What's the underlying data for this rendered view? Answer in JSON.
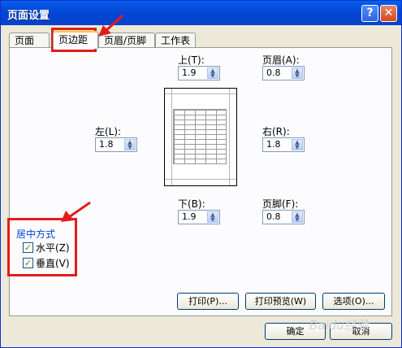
{
  "window": {
    "title": "页面设置",
    "help_label": "?",
    "close_label": "✕"
  },
  "tabs": [
    {
      "label": "页面",
      "active": false
    },
    {
      "label": "页边距",
      "active": true
    },
    {
      "label": "页眉/页脚",
      "active": false
    },
    {
      "label": "工作表",
      "active": false
    }
  ],
  "margins": {
    "top": {
      "label": "上(T):",
      "value": "1.9"
    },
    "header": {
      "label": "页眉(A):",
      "value": "0.8"
    },
    "left": {
      "label": "左(L):",
      "value": "1.8"
    },
    "right": {
      "label": "右(R):",
      "value": "1.8"
    },
    "bottom": {
      "label": "下(B):",
      "value": "1.9"
    },
    "footer": {
      "label": "页脚(F):",
      "value": "0.8"
    }
  },
  "centering": {
    "title": "居中方式",
    "horizontal": {
      "label": "水平(Z)",
      "checked": true
    },
    "vertical": {
      "label": "垂直(V)",
      "checked": true
    }
  },
  "buttons": {
    "print": "打印(P)...",
    "preview": "打印预览(W)",
    "options": "选项(O)...",
    "ok": "确定",
    "cancel": "取消"
  },
  "annotation_color": "#e41b1b",
  "watermark": "Baidu经验"
}
